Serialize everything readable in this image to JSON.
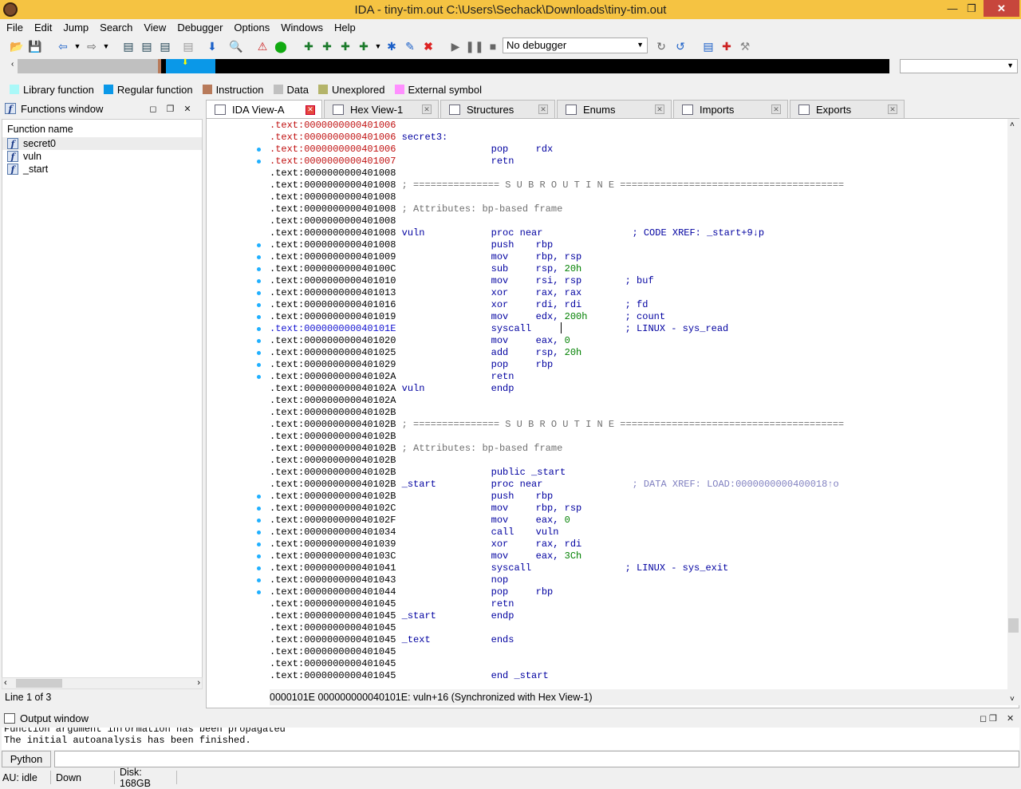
{
  "window": {
    "title": "IDA - tiny-tim.out C:\\Users\\Sechack\\Downloads\\tiny-tim.out"
  },
  "menu": [
    "File",
    "Edit",
    "Jump",
    "Search",
    "View",
    "Debugger",
    "Options",
    "Windows",
    "Help"
  ],
  "toolbar": {
    "debugger_select": "No debugger"
  },
  "legend": [
    {
      "label": "Library function",
      "color": "#aaf8f8"
    },
    {
      "label": "Regular function",
      "color": "#0a98e8"
    },
    {
      "label": "Instruction",
      "color": "#b87a5a"
    },
    {
      "label": "Data",
      "color": "#c0c0c0"
    },
    {
      "label": "Unexplored",
      "color": "#b4b46a"
    },
    {
      "label": "External symbol",
      "color": "#ff90ff"
    }
  ],
  "functions_window": {
    "title": "Functions window",
    "header": "Function name",
    "items": [
      "secret0",
      "vuln",
      "_start"
    ],
    "line_info": "Line 1 of 3"
  },
  "tabs": [
    "IDA View-A",
    "Hex View-1",
    "Structures",
    "Enums",
    "Imports",
    "Exports"
  ],
  "disasm_lines": [
    {
      "a": ".text:0000000000401006",
      "c": "red",
      "t": ""
    },
    {
      "a": ".text:0000000000401006",
      "c": "red",
      "t": "secret3:",
      "k": "lbl"
    },
    {
      "a": ".text:0000000000401006",
      "c": "red",
      "m": "pop",
      "o": "rdx"
    },
    {
      "a": ".text:0000000000401007",
      "c": "red",
      "m": "retn"
    },
    {
      "a": ".text:0000000000401008",
      "t": ""
    },
    {
      "a": ".text:0000000000401008",
      "t": "; =============== S U B R O U T I N E =======================================",
      "k": "gr"
    },
    {
      "a": ".text:0000000000401008",
      "t": ""
    },
    {
      "a": ".text:0000000000401008",
      "t": "; Attributes: bp-based frame",
      "k": "gr"
    },
    {
      "a": ".text:0000000000401008",
      "t": ""
    },
    {
      "a": ".text:0000000000401008",
      "lab": "vuln",
      "m": "proc near",
      "cm": "; CODE XREF: _start+9↓p"
    },
    {
      "a": ".text:0000000000401008",
      "m": "push",
      "o": "rbp"
    },
    {
      "a": ".text:0000000000401009",
      "m": "mov",
      "o": "rbp, rsp"
    },
    {
      "a": ".text:000000000040100C",
      "m": "sub",
      "o": "rsp, ",
      "n": "20h"
    },
    {
      "a": ".text:0000000000401010",
      "m": "mov",
      "o": "rsi, rsp",
      "cm": "; buf"
    },
    {
      "a": ".text:0000000000401013",
      "m": "xor",
      "o": "rax, rax"
    },
    {
      "a": ".text:0000000000401016",
      "m": "xor",
      "o": "rdi, rdi",
      "cm": "; fd"
    },
    {
      "a": ".text:0000000000401019",
      "m": "mov",
      "o": "edx, ",
      "n": "200h",
      "cm": "; count"
    },
    {
      "a": ".text:000000000040101E",
      "c": "blu",
      "m": "syscall",
      "cm": "; LINUX - sys_read"
    },
    {
      "a": ".text:0000000000401020",
      "m": "mov",
      "o": "eax, ",
      "n": "0"
    },
    {
      "a": ".text:0000000000401025",
      "m": "add",
      "o": "rsp, ",
      "n": "20h"
    },
    {
      "a": ".text:0000000000401029",
      "m": "pop",
      "o": "rbp"
    },
    {
      "a": ".text:000000000040102A",
      "m": "retn"
    },
    {
      "a": ".text:000000000040102A",
      "lab": "vuln",
      "m": "endp"
    },
    {
      "a": ".text:000000000040102A",
      "t": ""
    },
    {
      "a": ".text:000000000040102B",
      "t": ""
    },
    {
      "a": ".text:000000000040102B",
      "t": "; =============== S U B R O U T I N E =======================================",
      "k": "gr"
    },
    {
      "a": ".text:000000000040102B",
      "t": ""
    },
    {
      "a": ".text:000000000040102B",
      "t": "; Attributes: bp-based frame",
      "k": "gr"
    },
    {
      "a": ".text:000000000040102B",
      "t": ""
    },
    {
      "a": ".text:000000000040102B",
      "m": "public _start"
    },
    {
      "a": ".text:000000000040102B",
      "lab": "_start",
      "m": "proc near",
      "cmg": "; DATA XREF: LOAD:0000000000400018↑o"
    },
    {
      "a": ".text:000000000040102B",
      "m": "push",
      "o": "rbp"
    },
    {
      "a": ".text:000000000040102C",
      "m": "mov",
      "o": "rbp, rsp"
    },
    {
      "a": ".text:000000000040102F",
      "m": "mov",
      "o": "eax, ",
      "n": "0"
    },
    {
      "a": ".text:0000000000401034",
      "m": "call",
      "o": "vuln"
    },
    {
      "a": ".text:0000000000401039",
      "m": "xor",
      "o": "rax, rdi"
    },
    {
      "a": ".text:000000000040103C",
      "m": "mov",
      "o": "eax, ",
      "n": "3Ch"
    },
    {
      "a": ".text:0000000000401041",
      "m": "syscall",
      "cm": "; LINUX - sys_exit"
    },
    {
      "a": ".text:0000000000401043",
      "m": "nop"
    },
    {
      "a": ".text:0000000000401044",
      "m": "pop",
      "o": "rbp"
    },
    {
      "a": ".text:0000000000401045",
      "m": "retn"
    },
    {
      "a": ".text:0000000000401045",
      "lab": "_start",
      "m": "endp"
    },
    {
      "a": ".text:0000000000401045",
      "t": ""
    },
    {
      "a": ".text:0000000000401045",
      "lab": "_text",
      "m": "ends"
    },
    {
      "a": ".text:0000000000401045",
      "t": ""
    },
    {
      "a": ".text:0000000000401045",
      "t": ""
    },
    {
      "a": ".text:0000000000401045",
      "m": "end _start"
    }
  ],
  "disasm_status": "0000101E  000000000040101E: vuln+16 (Synchronized with Hex View-1)",
  "output_window": {
    "title": "Output window",
    "lines": [
      "Function argument information has been propagated",
      "The initial autoanalysis has been finished."
    ]
  },
  "python_button": "Python",
  "statusbar": {
    "au": "AU:  idle",
    "dir": "Down",
    "disk": "Disk: 168GB"
  }
}
